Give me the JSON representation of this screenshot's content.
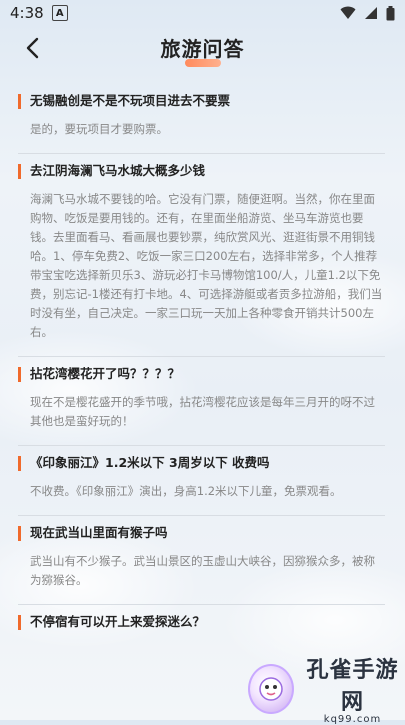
{
  "status_bar": {
    "time": "4:38",
    "badge": "A"
  },
  "header": {
    "title": "旅游问答"
  },
  "faqs": [
    {
      "question": "无锡融创是不是不玩项目进去不要票",
      "answer": "是的，要玩项目才要购票。"
    },
    {
      "question": "去江阴海澜飞马水城大概多少钱",
      "answer": "海澜飞马水城不要钱的哈。它没有门票，随便逛啊。当然，你在里面购物、吃饭是要用钱的。还有，在里面坐船游览、坐马车游览也要钱。去里面看马、看画展也要钞票，纯欣赏风光、逛逛街景不用铜钱哈。1、停车免费2、吃饭一家三口200左右，选择非常多，个人推荐带宝宝吃选择新贝乐3、游玩必打卡马博物馆100/人，儿童1.2以下免费，别忘记-1楼还有打卡地。4、可选择游艇或者贡多拉游船，我们当时没有坐，自己决定。一家三口玩一天加上各种零食开销共计500左右。"
    },
    {
      "question": "拈花湾樱花开了吗？？？？",
      "answer": "现在不是樱花盛开的季节哦，拈花湾樱花应该是每年三月开的呀不过其他也是蛮好玩的！"
    },
    {
      "question": "《印象丽江》1.2米以下 3周岁以下 收费吗",
      "answer": "不收费。《印象丽江》演出，身高1.2米以下儿童，免票观看。"
    },
    {
      "question": "现在武当山里面有猴子吗",
      "answer": "武当山有不少猴子。武当山景区的玉虚山大峡谷，因猕猴众多，被称为猕猴谷。"
    },
    {
      "question": "不停宿有可以开上来爱探迷么？",
      "answer": ""
    }
  ],
  "watermark": {
    "brand": "孔雀手游网",
    "url": "kq99.com"
  }
}
